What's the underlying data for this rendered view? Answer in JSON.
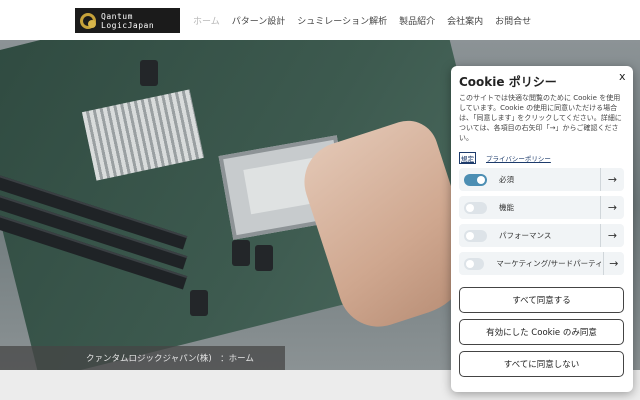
{
  "header": {
    "logo": {
      "line1": "Qantum",
      "line2": "LogicJapan"
    },
    "nav": [
      {
        "label": "ホーム",
        "active": true
      },
      {
        "label": "パターン設計",
        "active": false
      },
      {
        "label": "シュミレーション解析",
        "active": false
      },
      {
        "label": "製品紹介",
        "active": false
      },
      {
        "label": "会社案内",
        "active": false
      },
      {
        "label": "お問合せ",
        "active": false
      }
    ]
  },
  "hero": {
    "breadcrumb": "クァンタムロジックジャパン(株)　：ホーム"
  },
  "cookie": {
    "title": "Cookie ポリシー",
    "close": "x",
    "description": "このサイトでは快適な閲覧のために Cookie を使用しています。Cookie の使用に同意いただける場合は、｢同意します｣ をクリックしてください。詳細については、各項目の右矢印「→」からご確認ください。",
    "settings_link": "規定",
    "privacy_link": "プライバシーポリシー",
    "toggles": [
      {
        "label": "必須",
        "on": true
      },
      {
        "label": "機能",
        "on": false
      },
      {
        "label": "パフォーマンス",
        "on": false
      },
      {
        "label": "マーケティング/サードパーティ",
        "on": false
      }
    ],
    "arrow": "→",
    "buttons": {
      "accept_all": "すべて同意する",
      "accept_enabled": "有効にした Cookie のみ同意",
      "reject_all": "すべてに同意しない"
    }
  }
}
